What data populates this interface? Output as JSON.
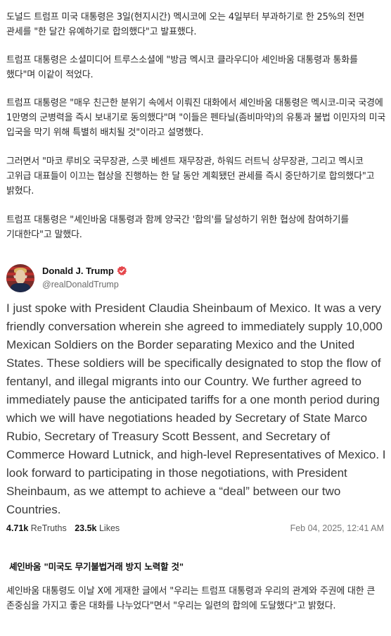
{
  "article": {
    "p1": "도널드 트럼프 미국 대통령은 3일(현지시간) 멕시코에 오는 4일부터 부과하기로 한 25%의 전면 관세를 \"한 달간 유예하기로 합의했다\"고 발표했다.",
    "p2": "트럼프 대통령은 소셜미디어 트루스소셜에 \"방금 멕시코 클라우디아 셰인바움 대통령과 통화를 했다\"며 이같이 적었다.",
    "p3": "트럼프 대통령은 \"매우 친근한 분위기 속에서 이뤄진 대화에서 셰인바움 대통령은 멕시코-미국 국경에 1만명의 군병력을 즉시 보내기로 동의했다\"며 \"이들은 펜타닐(좀비마약)의 유통과 불법 이민자의 미국 입국을 막기 위해 특별히 배치될 것\"이라고 설명했다.",
    "p4": "그러면서 \"마코 루비오 국무장관, 스콧 베센트 재무장관, 하워드 러트닉 상무장관, 그리고 멕시코 고위급 대표들이 이끄는 협상을 진행하는 한 달 동안 계획됐던 관세를 즉시 중단하기로 합의했다\"고 밝혔다.",
    "p5": "트럼프 대통령은 \"셰인바움 대통령과 함께 양국간 '합의'를 달성하기 위한 협상에 참여하기를 기대한다\"고 말했다.",
    "subheading": "셰인바움 \"미국도 무기불법거래 방지 노력할 것\"",
    "p6": "셰인바움 대통령도 이날 X에 게재한 글에서 \"우리는 트럼프 대통령과 우리의 관계와 주권에 대한 큰 존중심을 가지고 좋은 대화를 나누었다\"면서 \"우리는 일련의 합의에 도달했다\"고 밝혔다."
  },
  "post": {
    "author_name": "Donald J. Trump",
    "handle": "@realDonaldTrump",
    "verified_icon": "verified-badge-icon",
    "body": "I just spoke with President Claudia Sheinbaum of Mexico. It was a very friendly conversation wherein she agreed to immediately supply 10,000 Mexican Soldiers on the Border separating Mexico and the United States. These soldiers will be specifically designated to stop the flow of fentanyl, and illegal migrants into our Country. We further agreed to immediately pause the anticipated tariffs for a one month period during which we will have negotiations headed by Secretary of State Marco Rubio, Secretary of Treasury Scott Bessent, and Secretary of Commerce Howard Lutnick, and high-level Representatives of Mexico. I look forward to participating in those negotiations, with President Sheinbaum, as we attempt to achieve a “deal” between our two Countries.",
    "retruths_count": "4.71k",
    "retruths_label": "ReTruths",
    "likes_count": "23.5k",
    "likes_label": "Likes",
    "date": "Feb 04, 2025, 12:41 AM",
    "badge_color": "#e5484d"
  }
}
